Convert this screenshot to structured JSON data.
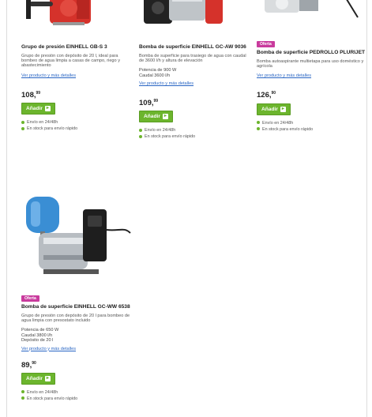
{
  "products": [
    {
      "title": "Grupo de presión EINHELL GB-S 3",
      "desc": "Grupo de presión con depósito de 20 l, ideal para bombeo de agua limpia a casas de campo, riego y abastecimiento",
      "specs": [],
      "link": "Ver producto y más detalles",
      "price_int": "108,",
      "price_dec": "99",
      "buy": "Añadir",
      "stock1": "Envío en 24/48h",
      "stock2": "En stock para envío rápido",
      "badge": ""
    },
    {
      "title": "Bomba de superficie EINHELL GC-AW 9036",
      "desc": "Bomba de superficie para trasiego de agua con caudal de 3600 l/h y altura de elevación",
      "specs": [
        "Potencia de 900 W",
        "Caudal 3600 l/h"
      ],
      "link": "Ver producto y más detalles",
      "price_int": "109,",
      "price_dec": "99",
      "buy": "Añadir",
      "stock1": "Envío en 24/48h",
      "stock2": "En stock para envío rápido",
      "badge": ""
    },
    {
      "title": "Bomba de superficie PEDROLLO PLURIJET",
      "desc": "Bomba autoaspirante multietapa para uso doméstico y agrícola",
      "specs": [],
      "link": "Ver producto y más detalles",
      "price_int": "126,",
      "price_dec": "90",
      "buy": "Añadir",
      "stock1": "Envío en 24/48h",
      "stock2": "En stock para envío rápido",
      "badge": "Oferta"
    },
    {
      "title": "Bomba de superficie EINHELL GC-WW 6538",
      "desc": "Grupo de presión con depósito de 20 l para bombeo de agua limpia con presostato incluido",
      "specs": [
        "Potencia de 650 W",
        "Caudal 3800 l/h",
        "Depósito de 20 l"
      ],
      "link": "Ver producto y más detalles",
      "price_int": "89,",
      "price_dec": "90",
      "buy": "Añadir",
      "stock1": "Envío en 24/48h",
      "stock2": "En stock para envío rápido",
      "badge": "Oferta"
    }
  ],
  "colors": {
    "accent": "#6cb52d",
    "badge": "#c93b9d",
    "link": "#2a66c4"
  }
}
